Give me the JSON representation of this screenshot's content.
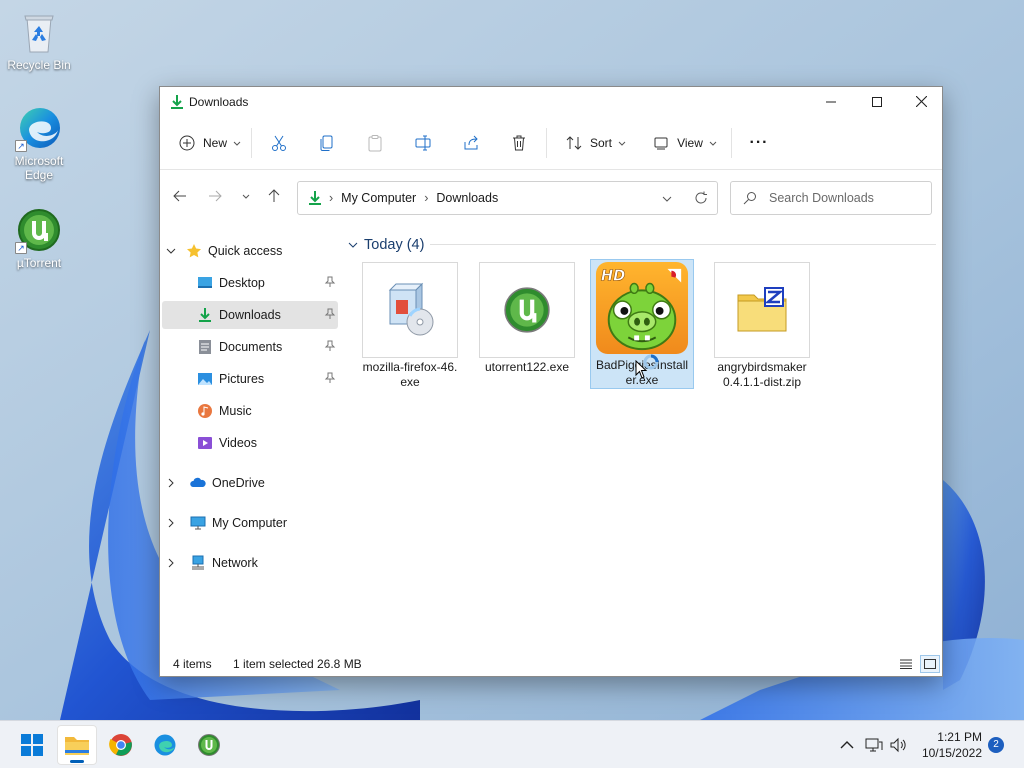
{
  "desktop": {
    "icons": [
      {
        "label": "Recycle Bin"
      },
      {
        "label": "Microsoft Edge"
      },
      {
        "label": "µTorrent"
      }
    ]
  },
  "window": {
    "title": "Downloads",
    "controls": {
      "minimize": "minimize",
      "maximize": "maximize",
      "close": "close"
    }
  },
  "toolbar": {
    "new_label": "New",
    "sort_label": "Sort",
    "view_label": "View",
    "more_label": "···"
  },
  "navigation": {
    "breadcrumb": [
      "My Computer",
      "Downloads"
    ],
    "breadcrumb_sep": "›",
    "search_placeholder": "Search Downloads"
  },
  "sidebar": {
    "quick_access": "Quick access",
    "items": [
      {
        "label": "Desktop",
        "icon": "desktop-icon",
        "pinned": true
      },
      {
        "label": "Downloads",
        "icon": "download-icon",
        "pinned": true,
        "selected": true
      },
      {
        "label": "Documents",
        "icon": "documents-icon",
        "pinned": true
      },
      {
        "label": "Pictures",
        "icon": "pictures-icon",
        "pinned": true
      },
      {
        "label": "Music",
        "icon": "music-icon",
        "pinned": false
      },
      {
        "label": "Videos",
        "icon": "videos-icon",
        "pinned": false
      }
    ],
    "roots": [
      {
        "label": "OneDrive",
        "icon": "cloud-icon"
      },
      {
        "label": "My Computer",
        "icon": "computer-icon"
      },
      {
        "label": "Network",
        "icon": "network-icon"
      }
    ]
  },
  "content": {
    "group_header": "Today (4)",
    "files": [
      {
        "name": "mozilla-firefox-46.exe",
        "icon": "installer-icon",
        "selected": false
      },
      {
        "name": "utorrent122.exe",
        "icon": "utorrent-icon",
        "selected": false
      },
      {
        "name": "BadPiggiesInstaller.exe",
        "icon": "bad-piggies-icon",
        "selected": true
      },
      {
        "name": "angrybirdsmaker0.4.1.1-dist.zip",
        "icon": "zip-archive-icon",
        "selected": false
      }
    ]
  },
  "statusbar": {
    "item_count": "4 items",
    "selection": "1 item selected",
    "size": "26.8 MB"
  },
  "taskbar": {
    "apps": [
      "start",
      "file-explorer",
      "chrome",
      "edge",
      "utorrent"
    ],
    "time": "1:21 PM",
    "date": "10/15/2022",
    "notification_count": "2"
  },
  "colors": {
    "accent": "#005fb8",
    "selection_bg": "#cce4f7",
    "download_green": "#14a34a",
    "folder_yellow": "#f2c84b"
  }
}
